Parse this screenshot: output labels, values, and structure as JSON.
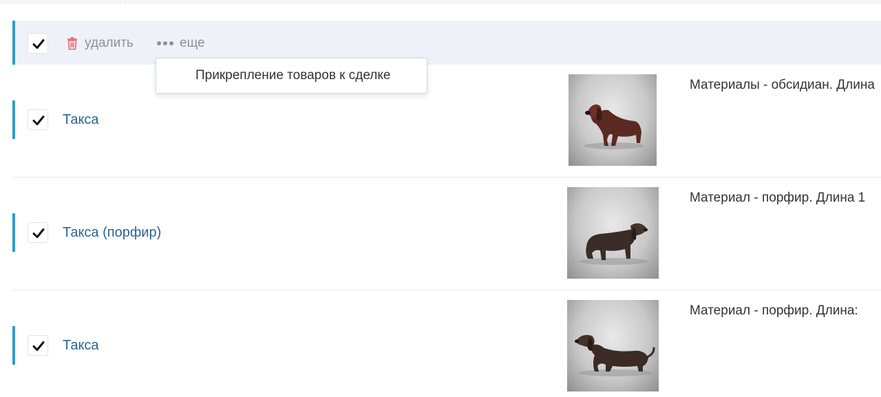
{
  "toolbar": {
    "delete_label": "удалить",
    "more_label": "еще",
    "delete_icon": "trash-icon",
    "more_icon": "dots-horizontal-icon",
    "delete_color": "#e57373"
  },
  "dropdown": {
    "items": [
      {
        "label": "Прикрепление товаров к сделке"
      }
    ]
  },
  "rows": [
    {
      "name": "Такса",
      "description": "Материалы - обсидиан. Длина",
      "selected": true,
      "image": "dachshund-figurine-obsidian"
    },
    {
      "name": "Такса (порфир)",
      "description": "Материал - порфир. Длина 1",
      "selected": true,
      "image": "dachshund-figurine-porphyry"
    },
    {
      "name": "Такса",
      "description": "Материал - порфир. Длина:",
      "selected": true,
      "image": "dachshund-figurine-porphyry-2"
    }
  ],
  "colors": {
    "accent": "#2f9bcf",
    "link": "#2a6496",
    "toolbar_bg": "#eef2f8"
  }
}
